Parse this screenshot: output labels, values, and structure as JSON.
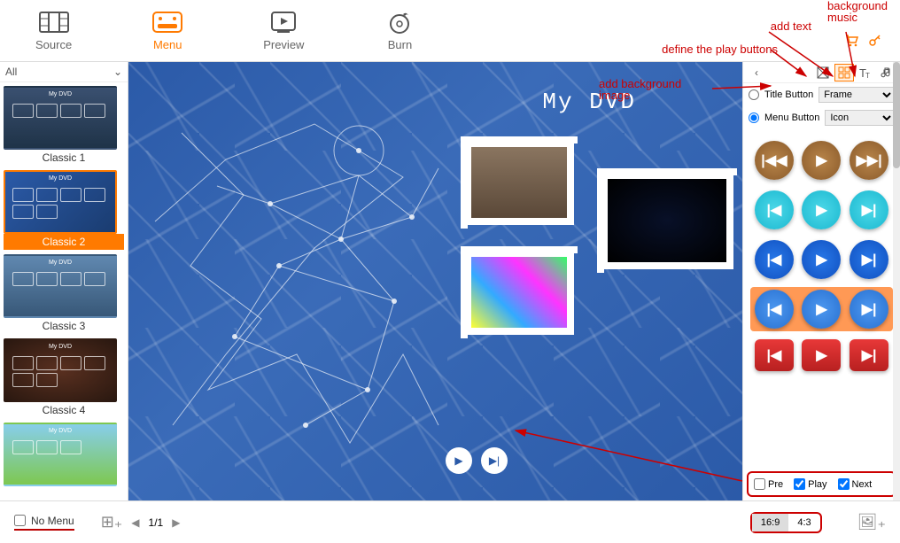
{
  "nav": {
    "source": "Source",
    "menu": "Menu",
    "preview": "Preview",
    "burn": "Burn"
  },
  "sidebar": {
    "filter": "All",
    "templates": [
      {
        "label": "Classic 1"
      },
      {
        "label": "Classic 2"
      },
      {
        "label": "Classic 3"
      },
      {
        "label": "Classic 4"
      },
      {
        "label": ""
      }
    ],
    "thumb_title": "My DVD"
  },
  "preview": {
    "title": "My DVD"
  },
  "right": {
    "nav_prev_icon": "chevron-left",
    "title_button_label": "Title Button",
    "title_select": "Frame",
    "menu_button_label": "Menu Button",
    "menu_select": "Icon",
    "checks": {
      "pre": "Pre",
      "play": "Play",
      "next": "Next"
    }
  },
  "bottom": {
    "nomenu": "No Menu",
    "page": "1/1",
    "aspect169": "16:9",
    "aspect43": "4:3"
  },
  "annotations": {
    "add_text": "add text",
    "bg_music": "background\nmusic",
    "define_play": "define the play buttons",
    "add_bg": "add background\nimage"
  }
}
